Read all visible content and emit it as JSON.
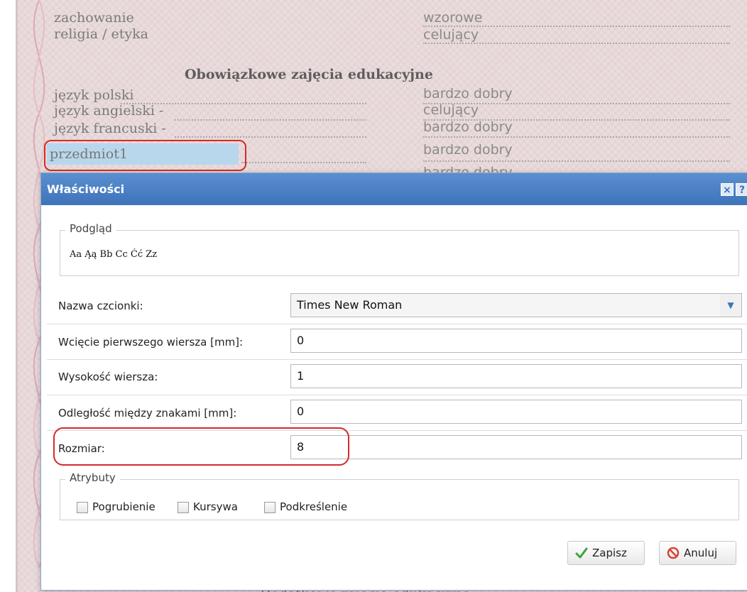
{
  "certificate": {
    "rows_top": [
      {
        "subject": "zachowanie",
        "grade": "wzorowe"
      },
      {
        "subject": "religia / etyka",
        "grade": "celujący"
      }
    ],
    "section_heading": "Obowiązkowe zajęcia edukacyjne",
    "rows_mandatory": [
      {
        "subject": "język polski",
        "grade": "bardzo dobry"
      },
      {
        "subject": "język angielski  -",
        "grade": "celujący"
      },
      {
        "subject": "język francuski  -",
        "grade": "bardzo dobry"
      },
      {
        "subject": "przedmiot1",
        "grade": "bardzo dobry"
      },
      {
        "subject": "",
        "grade": "bardzo dobry"
      }
    ],
    "bottom_partial": "Dodatkowe zajęcia edukacyjne"
  },
  "dialog": {
    "title": "Właściwości",
    "close_label": "×",
    "help_label": "?",
    "preview": {
      "legend": "Podgląd",
      "sample": "Aa Ąą Bb Cc Ćć Zz"
    },
    "fields": {
      "font_name": {
        "label": "Nazwa czcionki:",
        "value": "Times New Roman"
      },
      "indent": {
        "label": "Wcięcie pierwszego wiersza [mm]:",
        "value": "0"
      },
      "line_height": {
        "label": "Wysokość wiersza:",
        "value": "1"
      },
      "letter_spacing": {
        "label": "Odległość między znakami [mm]:",
        "value": "0"
      },
      "size": {
        "label": "Rozmiar:",
        "value": "8"
      }
    },
    "attributes": {
      "legend": "Atrybuty",
      "bold": {
        "label": "Pogrubienie",
        "checked": false
      },
      "italic": {
        "label": "Kursywa",
        "checked": false
      },
      "underline": {
        "label": "Podkreślenie",
        "checked": false
      }
    },
    "buttons": {
      "save": "Zapisz",
      "cancel": "Anuluj"
    }
  },
  "colors": {
    "titlebar": "#3e73ba",
    "highlight": "#b8d7ec",
    "annotation": "#d62a2a"
  }
}
